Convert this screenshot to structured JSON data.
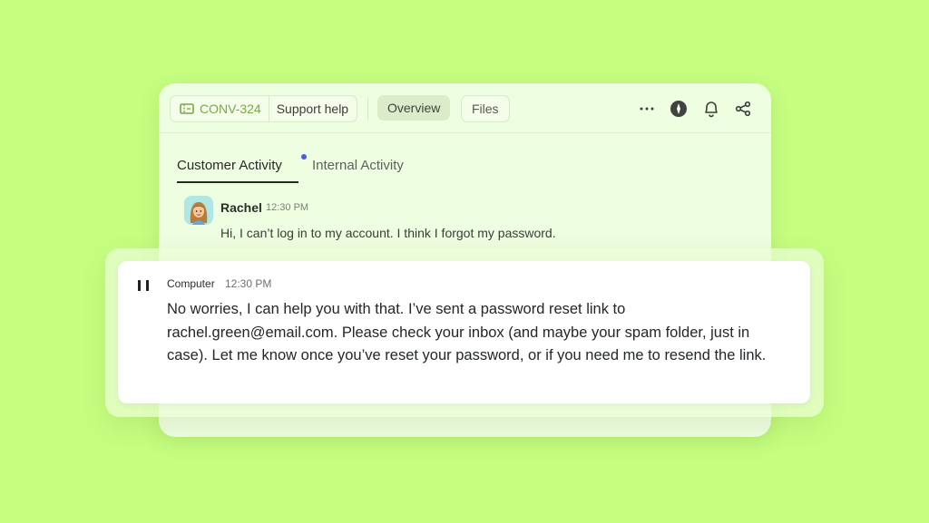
{
  "toolbar": {
    "conversation_id": "CONV-324",
    "category": "Support help",
    "tabs": [
      {
        "label": "Overview",
        "active": true
      },
      {
        "label": "Files",
        "active": false
      }
    ],
    "icons": [
      "ticket-icon",
      "more-icon",
      "compass-icon",
      "bell-icon",
      "share-icon"
    ]
  },
  "activity_tabs": [
    {
      "label": "Customer Activity",
      "active": true,
      "unread_dot": true
    },
    {
      "label": "Internal Activity",
      "active": false
    }
  ],
  "customer_message": {
    "author": "Rachel",
    "time": "12:30 PM",
    "text": "Hi, I can’t log in to my account. I think I forgot my password."
  },
  "reply": {
    "author": "Computer",
    "time": "12:30 PM",
    "text": "No worries, I can help you with that. I’ve sent a password reset link to rachel.green@email.com. Please check your inbox (and maybe your spam folder, just in case). Let me know once you’ve reset your password, or if you need me to resend the link."
  },
  "colors": {
    "background": "#c6fe80",
    "card": "#eefee0",
    "accent_green": "#7aa84a",
    "unread_dot": "#4d5be0"
  }
}
